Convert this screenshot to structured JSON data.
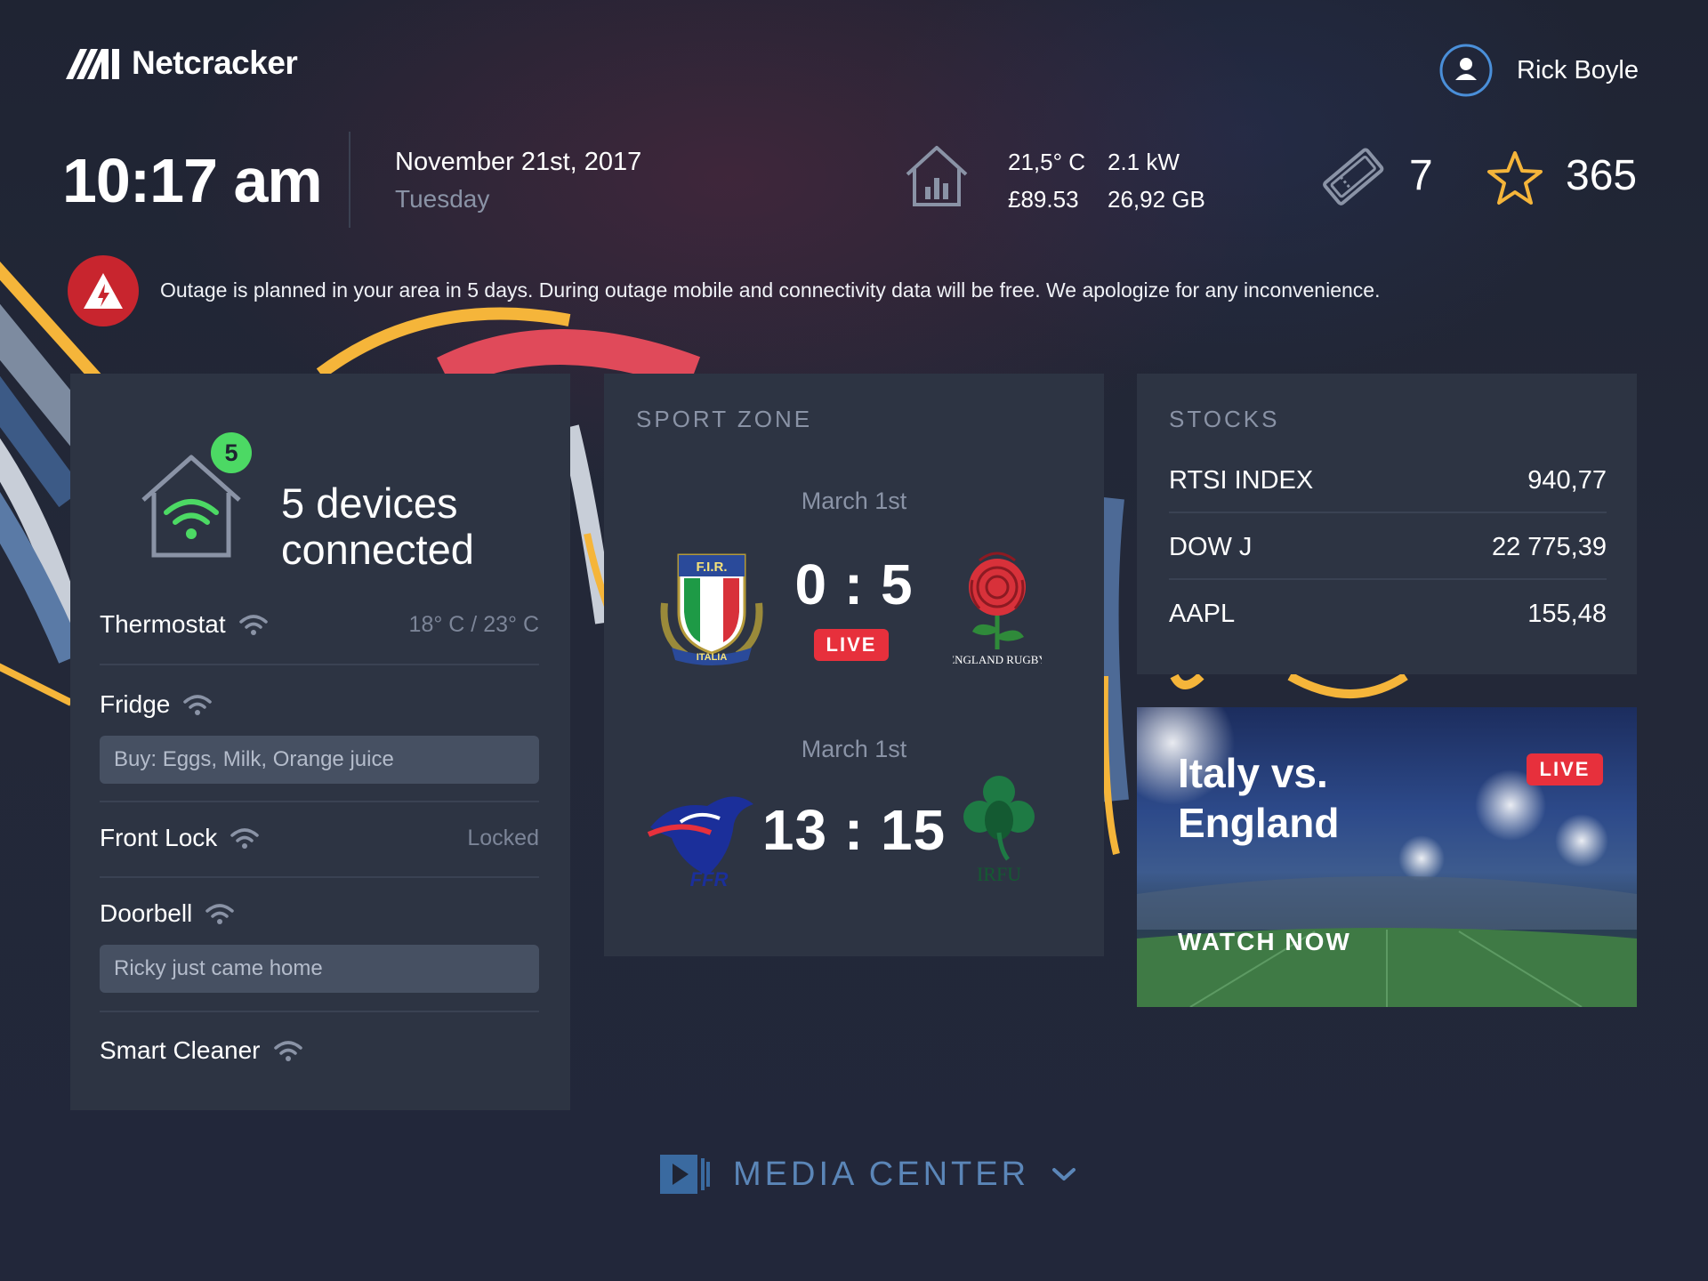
{
  "header": {
    "brand": "Netcracker",
    "user_name": "Rick Boyle",
    "time": "10:17 am",
    "date": "November 21st, 2017",
    "weekday": "Tuesday",
    "home_stats": {
      "temperature": "21,5° C",
      "power": "2.1 kW",
      "cost": "£89.53",
      "data": "26,92 GB"
    },
    "tickets_count": "7",
    "favorites_count": "365"
  },
  "alert": {
    "text": "Outage is planned in your area in 5 days. During outage mobile and connectivity data will be free. We apologize for any inconvenience."
  },
  "devices": {
    "badge": "5",
    "summary_line1": "5 devices",
    "summary_line2": "connected",
    "items": [
      {
        "name": "Thermostat",
        "meta": "18° C / 23° C"
      },
      {
        "name": "Fridge",
        "note": "Buy: Eggs, Milk, Orange juice"
      },
      {
        "name": "Front Lock",
        "meta": "Locked"
      },
      {
        "name": "Doorbell",
        "note": "Ricky just came home"
      },
      {
        "name": "Smart Cleaner"
      }
    ]
  },
  "sport": {
    "title": "SPORT ZONE",
    "matches": [
      {
        "date": "March 1st",
        "score": "0 : 5",
        "status": "LIVE",
        "home_badge": "F.I.R.",
        "home_ribbon": "ITALIA",
        "away_badge": "ENGLAND RUGBY"
      },
      {
        "date": "March 1st",
        "score": "13 : 15",
        "home_badge": "FFR",
        "away_badge": "IRFU"
      }
    ]
  },
  "stocks": {
    "title": "STOCKS",
    "rows": [
      {
        "name": "RTSI INDEX",
        "value": "940,77"
      },
      {
        "name": "DOW J",
        "value": "22 775,39"
      },
      {
        "name": "AAPL",
        "value": "155,48"
      }
    ]
  },
  "promo": {
    "title_line1": "Italy vs.",
    "title_line2": "England",
    "status": "LIVE",
    "cta": "WATCH NOW"
  },
  "media_center": {
    "label": "MEDIA CENTER"
  },
  "colors": {
    "background": "#22273a",
    "card": "#2d3443",
    "live_red": "#e7303c",
    "alert_red": "#c8252e",
    "wifi_green": "#4cd964",
    "star_yellow": "#f5b53a",
    "media_blue": "#5b86b8"
  }
}
